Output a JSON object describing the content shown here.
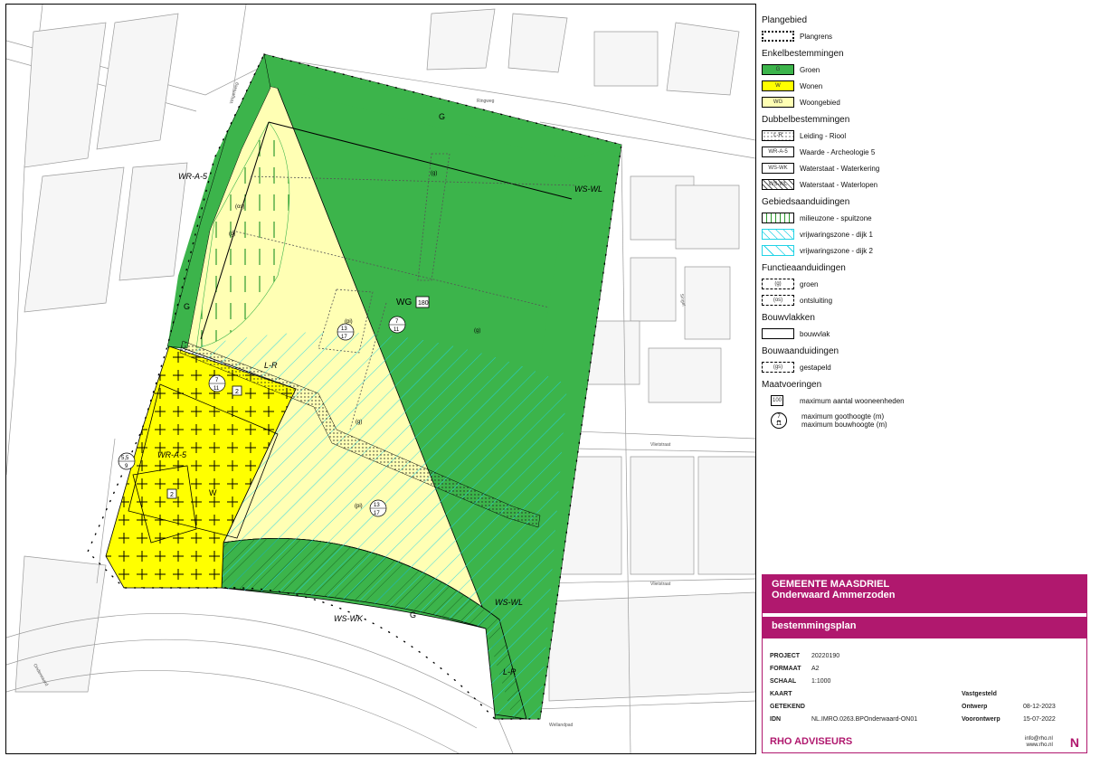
{
  "map": {
    "zone_labels": {
      "g_top": "G",
      "g_left": "G",
      "g_bottom": "G",
      "wg": "WG",
      "w": "W",
      "wg_units": "180",
      "w_units": "2",
      "w_units2": "2",
      "wra5_top": "WR-A-5",
      "wra5_mid": "WR-A-5",
      "wswl_top": "WS-WL",
      "wswl_bot": "WS-WL",
      "wswk": "WS-WK",
      "lr_top": "L-R",
      "lr_bot": "L-R",
      "g_paren1": "(g)",
      "g_paren2": "(g)",
      "g_paren3": "(g)",
      "g_paren4": "(g)",
      "os": "(os)",
      "pi1": "(pi)",
      "pi2": "(pi)",
      "h13": "13",
      "h17": "17",
      "h13b": "13",
      "h17b": "17",
      "h7a": "7",
      "h11a": "11",
      "h7b": "7",
      "h11b": "11",
      "h55": "5,5",
      "h9": "9"
    },
    "street_labels": [
      "Wilgenweg",
      "Onderwaard",
      "Vlietstraat",
      "Vlietstraat",
      "Wellandpad",
      "Ringweg",
      "Singel"
    ]
  },
  "legend": {
    "plangebied": {
      "title": "Plangebied",
      "items": [
        {
          "label": "Plangrens",
          "swatch": ""
        }
      ]
    },
    "enkel": {
      "title": "Enkelbestemmingen",
      "items": [
        {
          "label": "Groen",
          "swatch": "G"
        },
        {
          "label": "Wonen",
          "swatch": "W"
        },
        {
          "label": "Woongebied",
          "swatch": "WG"
        }
      ]
    },
    "dubbel": {
      "title": "Dubbelbestemmingen",
      "items": [
        {
          "label": "Leiding - Riool",
          "swatch": "L-R"
        },
        {
          "label": "Waarde - Archeologie 5",
          "swatch": "WR-A-5"
        },
        {
          "label": "Waterstaat - Waterkering",
          "swatch": "WS-WK"
        },
        {
          "label": "Waterstaat - Waterlopen",
          "swatch": "WS-WL"
        }
      ]
    },
    "gebied": {
      "title": "Gebiedsaanduidingen",
      "items": [
        {
          "label": "milieuzone - spuitzone",
          "swatch": ""
        },
        {
          "label": "vrijwaringszone - dijk 1",
          "swatch": ""
        },
        {
          "label": "vrijwaringszone - dijk 2",
          "swatch": ""
        }
      ]
    },
    "functie": {
      "title": "Functieaanduidingen",
      "items": [
        {
          "label": "groen",
          "swatch": "(g)"
        },
        {
          "label": "ontsluiting",
          "swatch": "(os)"
        }
      ]
    },
    "bouwvlak": {
      "title": "Bouwvlakken",
      "items": [
        {
          "label": "bouwvlak",
          "swatch": ""
        }
      ]
    },
    "bouwaand": {
      "title": "Bouwaanduidingen",
      "items": [
        {
          "label": "gestapeld",
          "swatch": "(gs)"
        }
      ]
    },
    "maat": {
      "title": "Maatvoeringen",
      "items": [
        {
          "label": "maximum aantal wooneenheden",
          "swatch": "100"
        },
        {
          "label": "maximum goothoogte (m)",
          "swatch": "7"
        },
        {
          "label": "maximum bouwhoogte (m)",
          "swatch": "11"
        }
      ]
    }
  },
  "titleblock": {
    "gemeente": "GEMEENTE MAASDRIEL",
    "project_name": "Onderwaard Ammerzoden",
    "type": "bestemmingsplan",
    "project_label": "PROJECT",
    "project_value": "20220190",
    "formaat_label": "FORMAAT",
    "formaat_value": "A2",
    "schaal_label": "SCHAAL",
    "schaal_value": "1:1000",
    "kaart_label": "KAART",
    "getekend_label": "GETEKEND",
    "idn_label": "IDN",
    "idn_value": "NL.IMRO.0263.BPOnderwaard-ON01",
    "vastgesteld_label": "Vastgesteld",
    "vastgesteld_value": "",
    "ontwerp_label": "Ontwerp",
    "ontwerp_value": "08-12-2023",
    "voorontwerp_label": "Voorontwerp",
    "voorontwerp_value": "15-07-2022",
    "company": "RHO ADVISEURS",
    "email": "info@rho.nl",
    "web": "www.rho.nl",
    "north": "N"
  },
  "colors": {
    "groen": "#3cb44b",
    "wonen": "#ffff00",
    "woongebied": "#ffffb4",
    "brand": "#b0186e",
    "water": "#22d3e6"
  }
}
